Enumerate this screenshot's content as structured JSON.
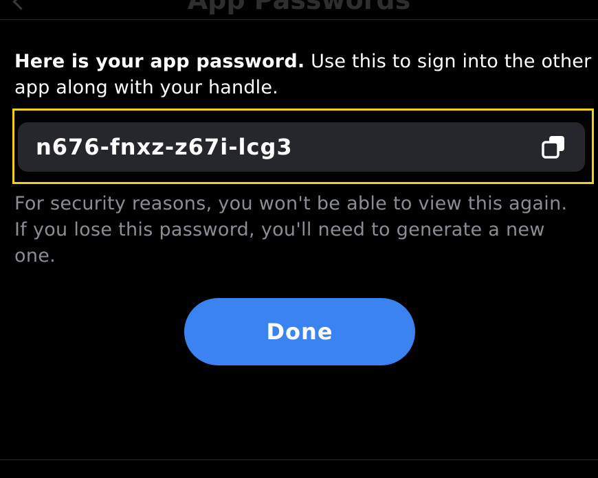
{
  "underlay": {
    "title": "App Passwords"
  },
  "intro": {
    "bold": "Here is your app password.",
    "rest": " Use this to sign into the other app along with your handle."
  },
  "password": {
    "value": "n676-fnxz-z67i-lcg3",
    "copy_icon": "copy-icon"
  },
  "warning": "For security reasons, you won't be able to view this again. If you lose this password, you'll need to generate a new one.",
  "done_label": "Done",
  "colors": {
    "background": "#000000",
    "field": "#26272d",
    "highlight": "#f5d016",
    "primary": "#3a83f1",
    "muted_text": "#8a8d94"
  }
}
